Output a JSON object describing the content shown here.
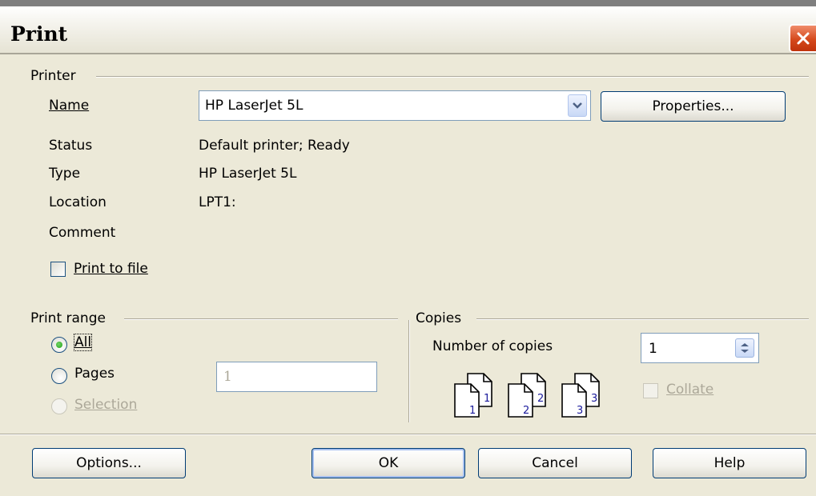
{
  "window": {
    "title": "Print"
  },
  "printer_group": {
    "label": "Printer",
    "name_label": "Name",
    "name_value": "HP LaserJet 5L",
    "properties_button": "Properties...",
    "status_label": "Status",
    "status_value": "Default printer; Ready",
    "type_label": "Type",
    "type_value": "HP LaserJet 5L",
    "location_label": "Location",
    "location_value": "LPT1:",
    "comment_label": "Comment",
    "print_to_file": {
      "label": "Print to file",
      "checked": false
    }
  },
  "print_range": {
    "label": "Print range",
    "options": [
      {
        "label": "All",
        "selected": true,
        "enabled": true
      },
      {
        "label": "Pages",
        "selected": false,
        "enabled": true
      },
      {
        "label": "Selection",
        "selected": false,
        "enabled": false
      }
    ],
    "pages_value": "1"
  },
  "copies": {
    "label": "Copies",
    "number_label": "Number of copies",
    "number_value": "1",
    "collate": {
      "label": "Collate",
      "checked": false,
      "enabled": false
    },
    "page_icons": [
      {
        "front": "1",
        "back": "1"
      },
      {
        "front": "2",
        "back": "2"
      },
      {
        "front": "3",
        "back": "3"
      }
    ]
  },
  "buttons": {
    "options": "Options...",
    "ok": "OK",
    "cancel": "Cancel",
    "help": "Help"
  },
  "colors": {
    "dialog_bg": "#ece9d8",
    "close_red": "#d5491c",
    "button_border": "#003c74",
    "radio_green": "#21a116",
    "disabled_text": "#aca899"
  },
  "icons": [
    "close-icon",
    "chevron-down-icon",
    "spin-updown-icon",
    "page-stack-icon"
  ]
}
